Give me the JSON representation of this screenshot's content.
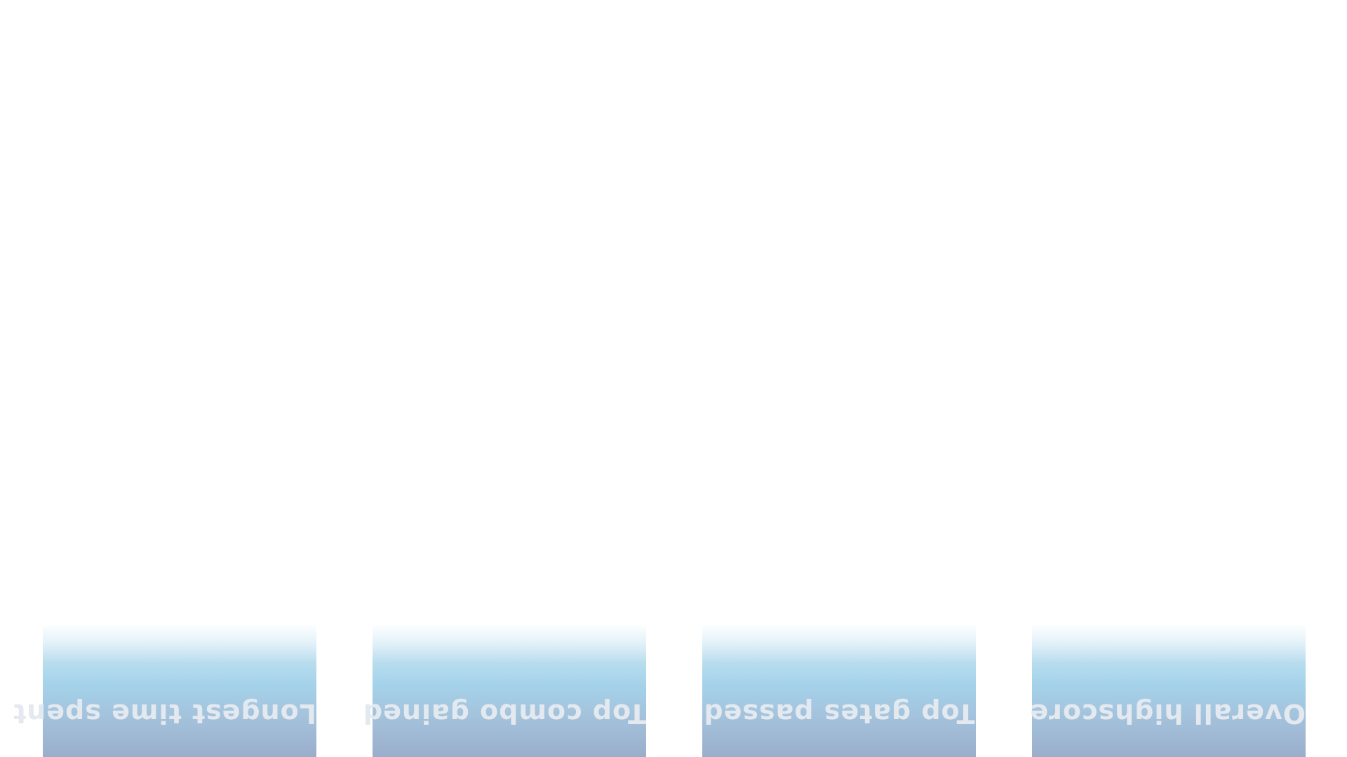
{
  "leaderboard_tabs": [
    {
      "label": "Longest time spent"
    },
    {
      "label": "Top combo gained"
    },
    {
      "label": "Top gates passed"
    },
    {
      "label": "Overall highscore"
    }
  ],
  "colors": {
    "background": "#ffffff",
    "tile_gradient_mid": "#a4d2ea",
    "tile_gradient_bottom": "#9aaecb",
    "label_text": "#e3e9ee"
  },
  "label_orientation": "upside-down"
}
